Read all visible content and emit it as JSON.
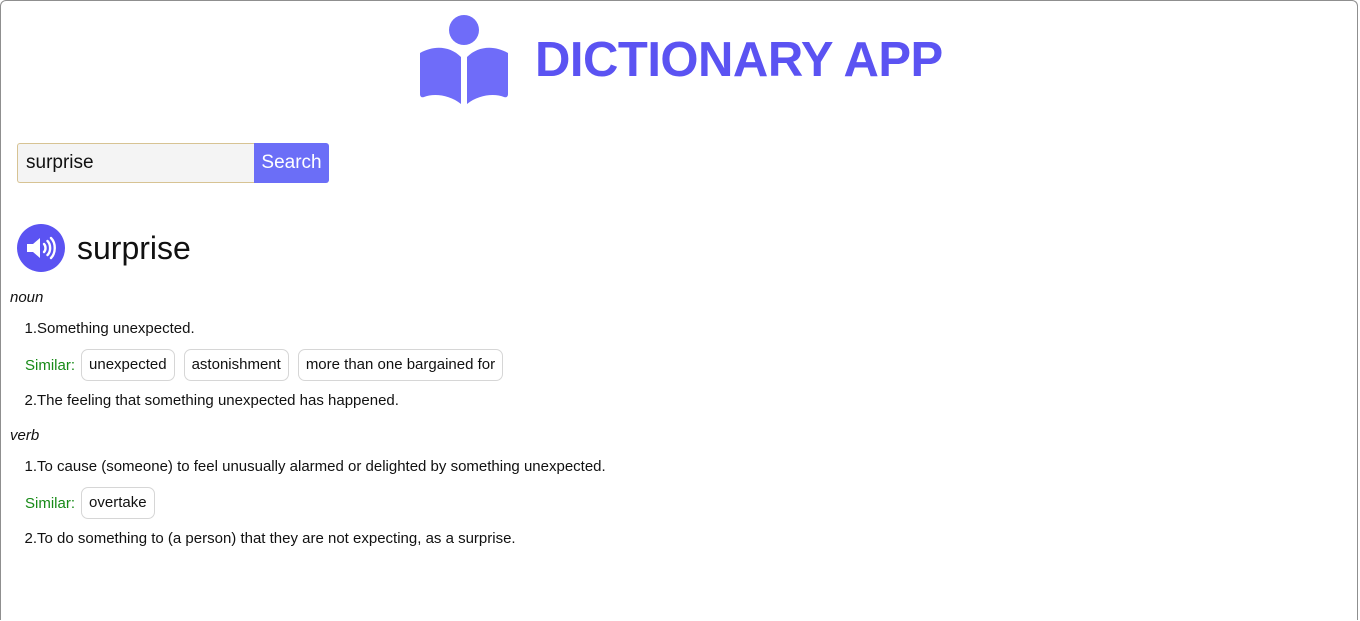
{
  "header": {
    "title": "DICTIONARY APP",
    "logo_icon": "reader-book-icon"
  },
  "search": {
    "value": "surprise",
    "button_label": "Search"
  },
  "result": {
    "word": "surprise",
    "audio_icon": "speaker-icon",
    "similar_label": "Similar:",
    "meanings": [
      {
        "part_of_speech": "noun",
        "definitions": [
          {
            "number": "1.",
            "text": "Something unexpected.",
            "synonyms": [
              "unexpected",
              "astonishment",
              "more than one bargained for"
            ]
          },
          {
            "number": "2.",
            "text": "The feeling that something unexpected has happened.",
            "synonyms": []
          }
        ]
      },
      {
        "part_of_speech": "verb",
        "definitions": [
          {
            "number": "1.",
            "text": "To cause (someone) to feel unusually alarmed or delighted by something unexpected.",
            "synonyms": [
              "overtake"
            ]
          },
          {
            "number": "2.",
            "text": "To do something to (a person) that they are not expecting, as a surprise.",
            "synonyms": []
          }
        ]
      }
    ]
  },
  "colors": {
    "accent": "#5b53f2",
    "button": "#6b6ef7",
    "logo": "#6f6cf9",
    "similar_label": "#178a17"
  }
}
